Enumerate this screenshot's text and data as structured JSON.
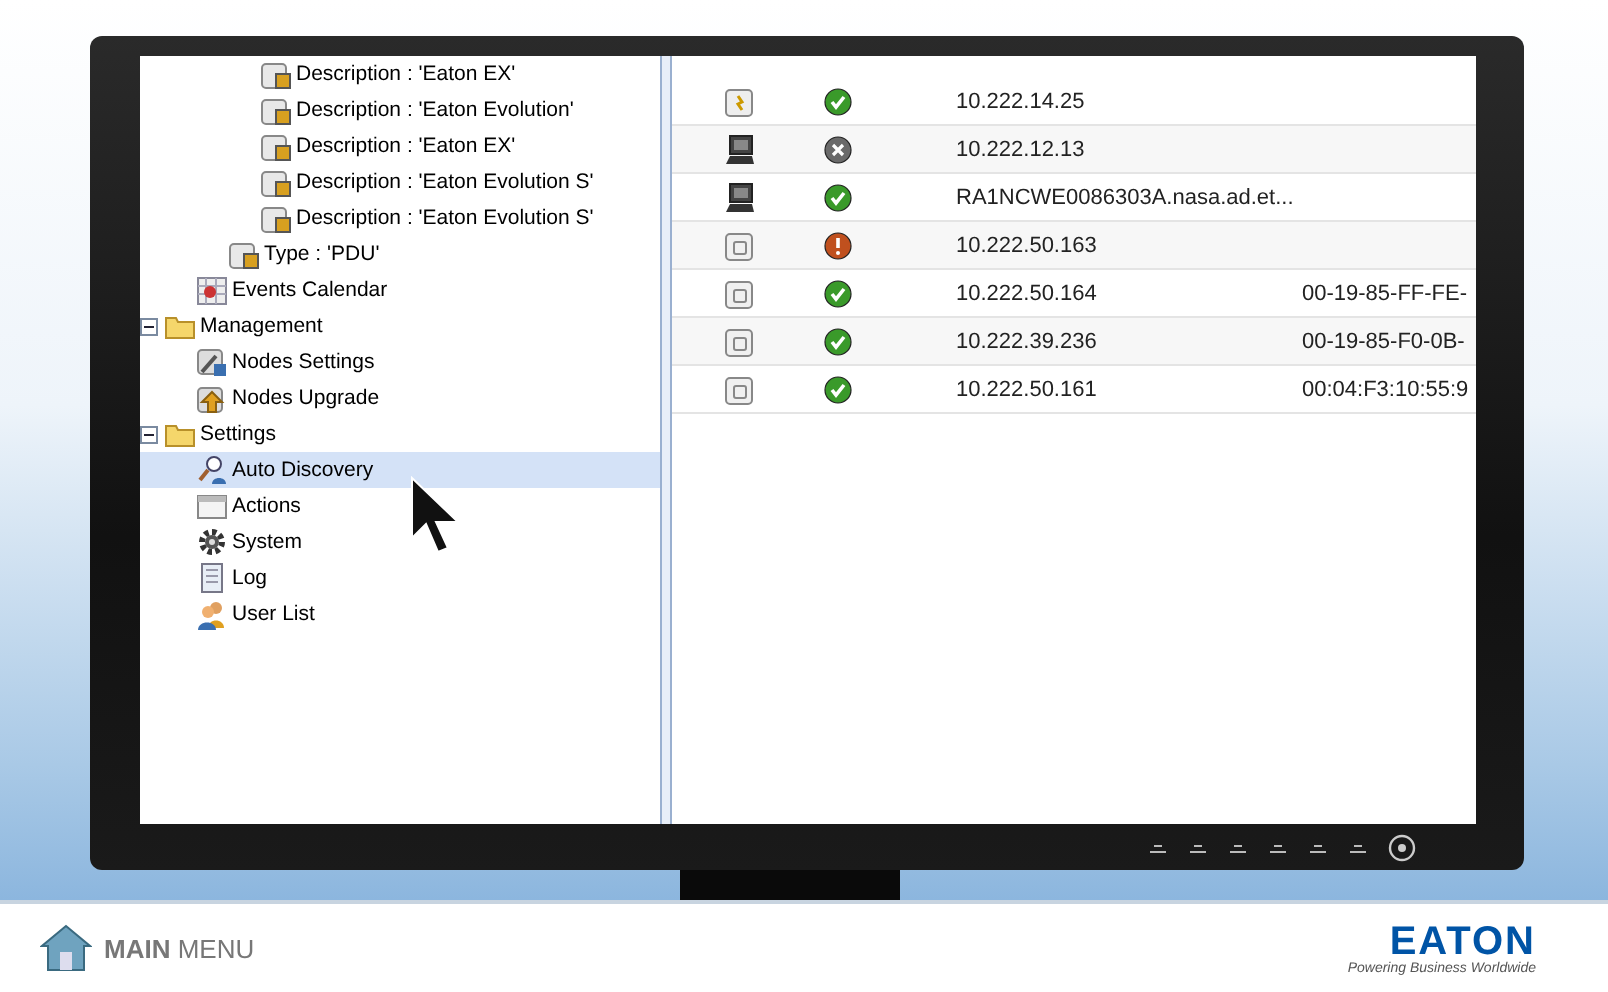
{
  "tree": [
    {
      "children": [
        {
          "children": [
            {
              "children": [
                {
                  "label": "Description : 'Eaton EX'",
                  "kind": "device",
                  "selected": false
                },
                {
                  "label": "Description : 'Eaton Evolution'",
                  "kind": "device",
                  "selected": false
                },
                {
                  "label": "Description : 'Eaton EX'",
                  "kind": "device",
                  "selected": false
                },
                {
                  "label": "Description : 'Eaton Evolution S'",
                  "kind": "device",
                  "selected": false
                },
                {
                  "label": "Description : 'Eaton Evolution S'",
                  "kind": "device",
                  "selected": false
                }
              ]
            },
            {
              "label": "Type : 'PDU'",
              "kind": "device",
              "selected": false
            }
          ]
        },
        {
          "label": "Events Calendar",
          "kind": "calendar",
          "selected": false
        }
      ]
    },
    {
      "label": "Management",
      "kind": "folder",
      "expanded": true,
      "selected": false,
      "children": [
        {
          "label": "Nodes Settings",
          "kind": "settings",
          "selected": false
        },
        {
          "label": "Nodes Upgrade",
          "kind": "upgrade",
          "selected": false
        }
      ]
    },
    {
      "label": "Settings",
      "kind": "folder",
      "expanded": true,
      "selected": false,
      "children": [
        {
          "label": "Auto Discovery",
          "kind": "discovery",
          "selected": true
        },
        {
          "label": "Actions",
          "kind": "window",
          "selected": false
        },
        {
          "label": "System",
          "kind": "gear",
          "selected": false
        },
        {
          "label": "Log",
          "kind": "document",
          "selected": false
        },
        {
          "label": "User List",
          "kind": "users",
          "selected": false
        }
      ]
    }
  ],
  "nodes": [
    {
      "device": {
        "kind": "card"
      },
      "status": {
        "kind": "ok"
      },
      "address": "10.222.14.25"
    },
    {
      "device": {
        "kind": "computer"
      },
      "status": {
        "kind": "offline"
      },
      "address": "10.222.12.13"
    },
    {
      "device": {
        "kind": "computer"
      },
      "status": {
        "kind": "ok"
      },
      "address": "RA1NCWE0086303A.nasa.ad.et..."
    },
    {
      "device": {
        "kind": "box"
      },
      "status": {
        "kind": "warning"
      },
      "address": "10.222.50.163"
    },
    {
      "device": {
        "kind": "box"
      },
      "status": {
        "kind": "ok"
      },
      "address": "10.222.50.164",
      "mac": "00-19-85-FF-FE-"
    },
    {
      "device": {
        "kind": "box"
      },
      "status": {
        "kind": "ok"
      },
      "address": "10.222.39.236",
      "mac": "00-19-85-F0-0B-"
    },
    {
      "device": {
        "kind": "box"
      },
      "status": {
        "kind": "ok"
      },
      "address": "10.222.50.161",
      "mac": "00:04:F3:10:55:9"
    }
  ],
  "footer": {
    "menu_link": "**MAIN** MENU",
    "logo": "EATON",
    "tagline": "Powering Business Worldwide"
  }
}
